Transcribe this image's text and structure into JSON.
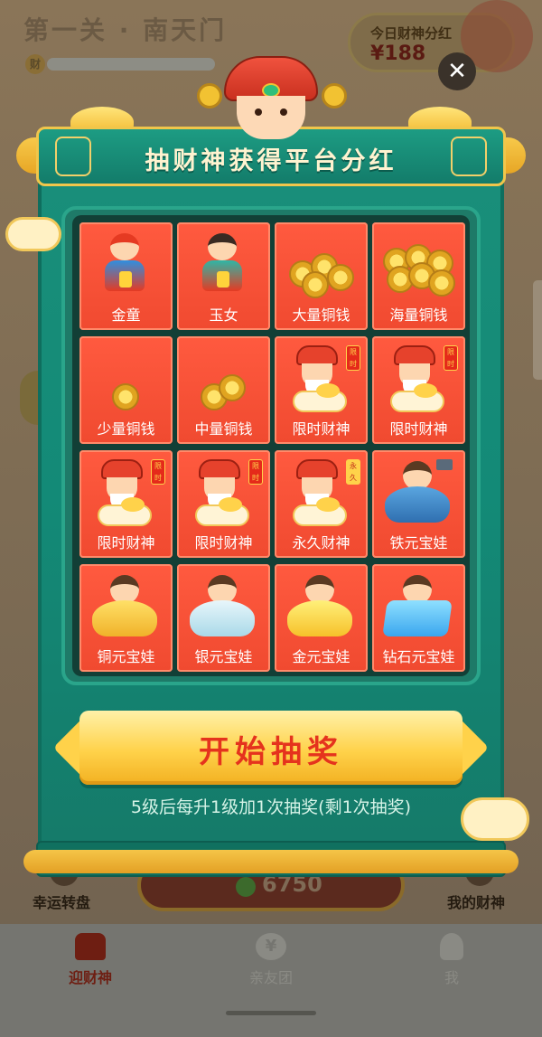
{
  "background": {
    "stage_title": "第一关 · 南天门",
    "bonus_label": "今日财神分红",
    "bonus_value": "¥188",
    "score": "6750",
    "left_action": "幸运转盘",
    "right_action": "我的财神"
  },
  "tabbar": {
    "tabs": [
      {
        "label": "迎财神",
        "active": true
      },
      {
        "label": "亲友团",
        "active": false
      },
      {
        "label": "我",
        "active": false
      }
    ]
  },
  "modal": {
    "close_glyph": "✕",
    "title": "抽财神获得平台分红",
    "prizes": [
      {
        "label": "金童",
        "icon": "golden-boy-icon"
      },
      {
        "label": "玉女",
        "icon": "jade-girl-icon"
      },
      {
        "label": "大量铜钱",
        "icon": "many-coins-icon"
      },
      {
        "label": "海量铜钱",
        "icon": "mass-coins-icon"
      },
      {
        "label": "少量铜钱",
        "icon": "few-coins-icon"
      },
      {
        "label": "中量铜钱",
        "icon": "medium-coins-icon"
      },
      {
        "label": "限时财神",
        "icon": "wealth-god-icon",
        "badge": "限时"
      },
      {
        "label": "限时财神",
        "icon": "wealth-god-icon",
        "badge": "限时"
      },
      {
        "label": "限时财神",
        "icon": "wealth-god-icon",
        "badge": "限时"
      },
      {
        "label": "限时财神",
        "icon": "wealth-god-icon",
        "badge": "限时"
      },
      {
        "label": "永久财神",
        "icon": "wealth-god-icon",
        "badge": "永久"
      },
      {
        "label": "铁元宝娃",
        "icon": "iron-ingot-baby-icon"
      },
      {
        "label": "铜元宝娃",
        "icon": "copper-ingot-baby-icon"
      },
      {
        "label": "银元宝娃",
        "icon": "silver-ingot-baby-icon"
      },
      {
        "label": "金元宝娃",
        "icon": "gold-ingot-baby-icon"
      },
      {
        "label": "钻石元宝娃",
        "icon": "diamond-ingot-baby-icon"
      }
    ],
    "start_button": "开始抽奖",
    "hint": "5级后每升1级加1次抽奖(剩1次抽奖)"
  },
  "colors": {
    "modal_green": "#138a77",
    "prize_red": "#f04a30",
    "button_gold": "#ffd24a",
    "button_text": "#e5331d"
  }
}
